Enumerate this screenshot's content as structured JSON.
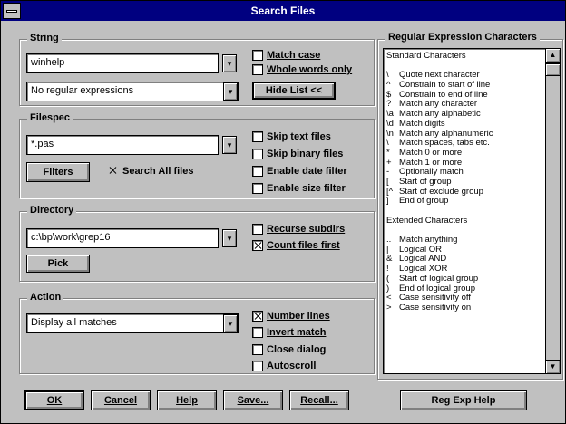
{
  "window": {
    "title": "Search Files"
  },
  "string_group": {
    "title": "String",
    "search_value": "winhelp",
    "regex_mode": "No regular expressions",
    "match_case": "Match case",
    "whole_words": "Whole words only",
    "hide_button": "Hide List <<"
  },
  "file_group": {
    "title": "Filespec",
    "filespec_value": "*.pas",
    "filters_button": "Filters",
    "search_all_files": "Search All files",
    "skip_text_files": "Skip text files",
    "skip_binary_files": "Skip binary files",
    "enable_date_filter": "Enable date filter",
    "enable_size_filter": "Enable size filter"
  },
  "dir_group": {
    "title": "Directory",
    "dir_value": "c:\\bp\\work\\grep16",
    "pick_button": "Pick",
    "recurse_subdirs": "Recurse subdirs",
    "count_files_first": "Count files first"
  },
  "action_group": {
    "title": "Action",
    "action_value": "Display all matches",
    "number_lines": "Number lines",
    "invert_match": "Invert match",
    "close_dialog": "Close dialog",
    "autoscroll": "Autoscroll"
  },
  "regex_panel": {
    "title": "Regular Expression Characters",
    "std_heading": "Standard Characters",
    "std_rows": [
      {
        "sym": "\\",
        "desc": "Quote next character"
      },
      {
        "sym": "^",
        "desc": "Constrain to start of line"
      },
      {
        "sym": "$",
        "desc": "Constrain to end of line"
      },
      {
        "sym": "?",
        "desc": "Match any character"
      },
      {
        "sym": "\\a",
        "desc": "Match any alphabetic"
      },
      {
        "sym": "\\d",
        "desc": "Match digits"
      },
      {
        "sym": "\\n",
        "desc": "Match any alphanumeric"
      },
      {
        "sym": "\\",
        "desc": "Match spaces, tabs etc."
      },
      {
        "sym": "*",
        "desc": "Match 0 or more"
      },
      {
        "sym": "+",
        "desc": "Match 1 or more"
      },
      {
        "sym": "-",
        "desc": "Optionally match"
      },
      {
        "sym": "[",
        "desc": "Start of group"
      },
      {
        "sym": "[^",
        "desc": "Start of exclude group"
      },
      {
        "sym": "]",
        "desc": "End of group"
      }
    ],
    "ext_heading": "Extended Characters",
    "ext_rows": [
      {
        "sym": "..",
        "desc": "Match anything"
      },
      {
        "sym": "|",
        "desc": "Logical OR"
      },
      {
        "sym": "&",
        "desc": "Logical AND"
      },
      {
        "sym": "!",
        "desc": "Logical XOR"
      },
      {
        "sym": "(",
        "desc": "Start of logical group"
      },
      {
        "sym": ")",
        "desc": "End of logical group"
      },
      {
        "sym": "<",
        "desc": "Case sensitivity off"
      },
      {
        "sym": ">",
        "desc": "Case sensitivity on"
      }
    ]
  },
  "buttons": {
    "ok": "OK",
    "cancel": "Cancel",
    "help": "Help",
    "save": "Save...",
    "recall": "Recall...",
    "regex_help": "Reg Exp Help"
  },
  "checks": {
    "match_case": false,
    "whole_words": false,
    "search_all_files": true,
    "skip_text_files": false,
    "skip_binary_files": false,
    "enable_date_filter": false,
    "enable_size_filter": false,
    "recurse_subdirs": false,
    "count_files_first": true,
    "number_lines": true,
    "invert_match": false,
    "close_dialog": false,
    "autoscroll": false
  },
  "icons": {
    "dropdown": "down-arrow-icon",
    "scroll_up": "up-arrow-icon",
    "scroll_down": "down-arrow-icon"
  }
}
